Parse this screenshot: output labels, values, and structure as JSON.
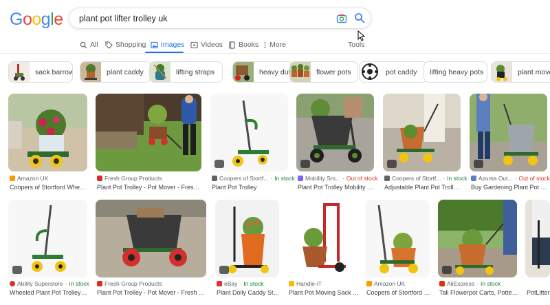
{
  "search": {
    "query": "plant pot lifter trolley  uk"
  },
  "tabs": [
    {
      "label": "All",
      "icon": "search-icon"
    },
    {
      "label": "Shopping",
      "icon": "tag-icon"
    },
    {
      "label": "Images",
      "icon": "image-icon",
      "active": true
    },
    {
      "label": "Videos",
      "icon": "play-icon"
    },
    {
      "label": "Books",
      "icon": "book-icon"
    },
    {
      "label": "More",
      "icon": "more-icon"
    }
  ],
  "tools_label": "Tools",
  "chips": [
    "sack barrow",
    "plant caddy",
    "lifting straps",
    "heavy duty",
    "flower pots",
    "pot caddy",
    "lifting heavy pots",
    "plant mover"
  ],
  "row1": [
    {
      "source": "Amazon UK",
      "stock": "",
      "title": "Coopers of Stortford Wheele..."
    },
    {
      "source": "Fresh Group Products",
      "stock": "",
      "title": "Plant Pot Trolley - Pot Mover - Fresh ..."
    },
    {
      "source": "Coopers of Stortf...",
      "stock": "In stock",
      "title": "Plant Pot Trolley"
    },
    {
      "source": "Mobility Sm...",
      "stock": "Out of stock",
      "title": "Plant Pot Trolley Mobility Sm..."
    },
    {
      "source": "Coopers of Stortf...",
      "stock": "In stock",
      "title": "Adjustable Plant Pot Trolley - ..."
    },
    {
      "source": "Azuma Out...",
      "stock": "Out of stock",
      "title": "Buy Gardening Plant Pot Troll..."
    }
  ],
  "row2": [
    {
      "source": "Ability Superstore",
      "stock": "In stock",
      "title": "Wheeled Plant Pot Trolley – A..."
    },
    {
      "source": "Fresh Group Products",
      "stock": "",
      "title": "Plant Pot Trolley - Pot Mover - Fresh ..."
    },
    {
      "source": "eBay",
      "stock": "In stock",
      "title": "Plant Dolly Caddy Stan..."
    },
    {
      "source": "Handle-iT",
      "stock": "",
      "title": "Plant Pot Moving Sack Ba..."
    },
    {
      "source": "Amazon UK",
      "stock": "",
      "title": "Coopers of Stortford W..."
    },
    {
      "source": "AliExpress",
      "stock": "In stock",
      "title": "Tall Flowerpot Carts, Potted P..."
    },
    {
      "source": "",
      "stock": "",
      "title": "PotLifter"
    }
  ],
  "colors": {
    "accent": "#1a73e8",
    "in_stock": "#188038",
    "out_of_stock": "#d93025"
  }
}
